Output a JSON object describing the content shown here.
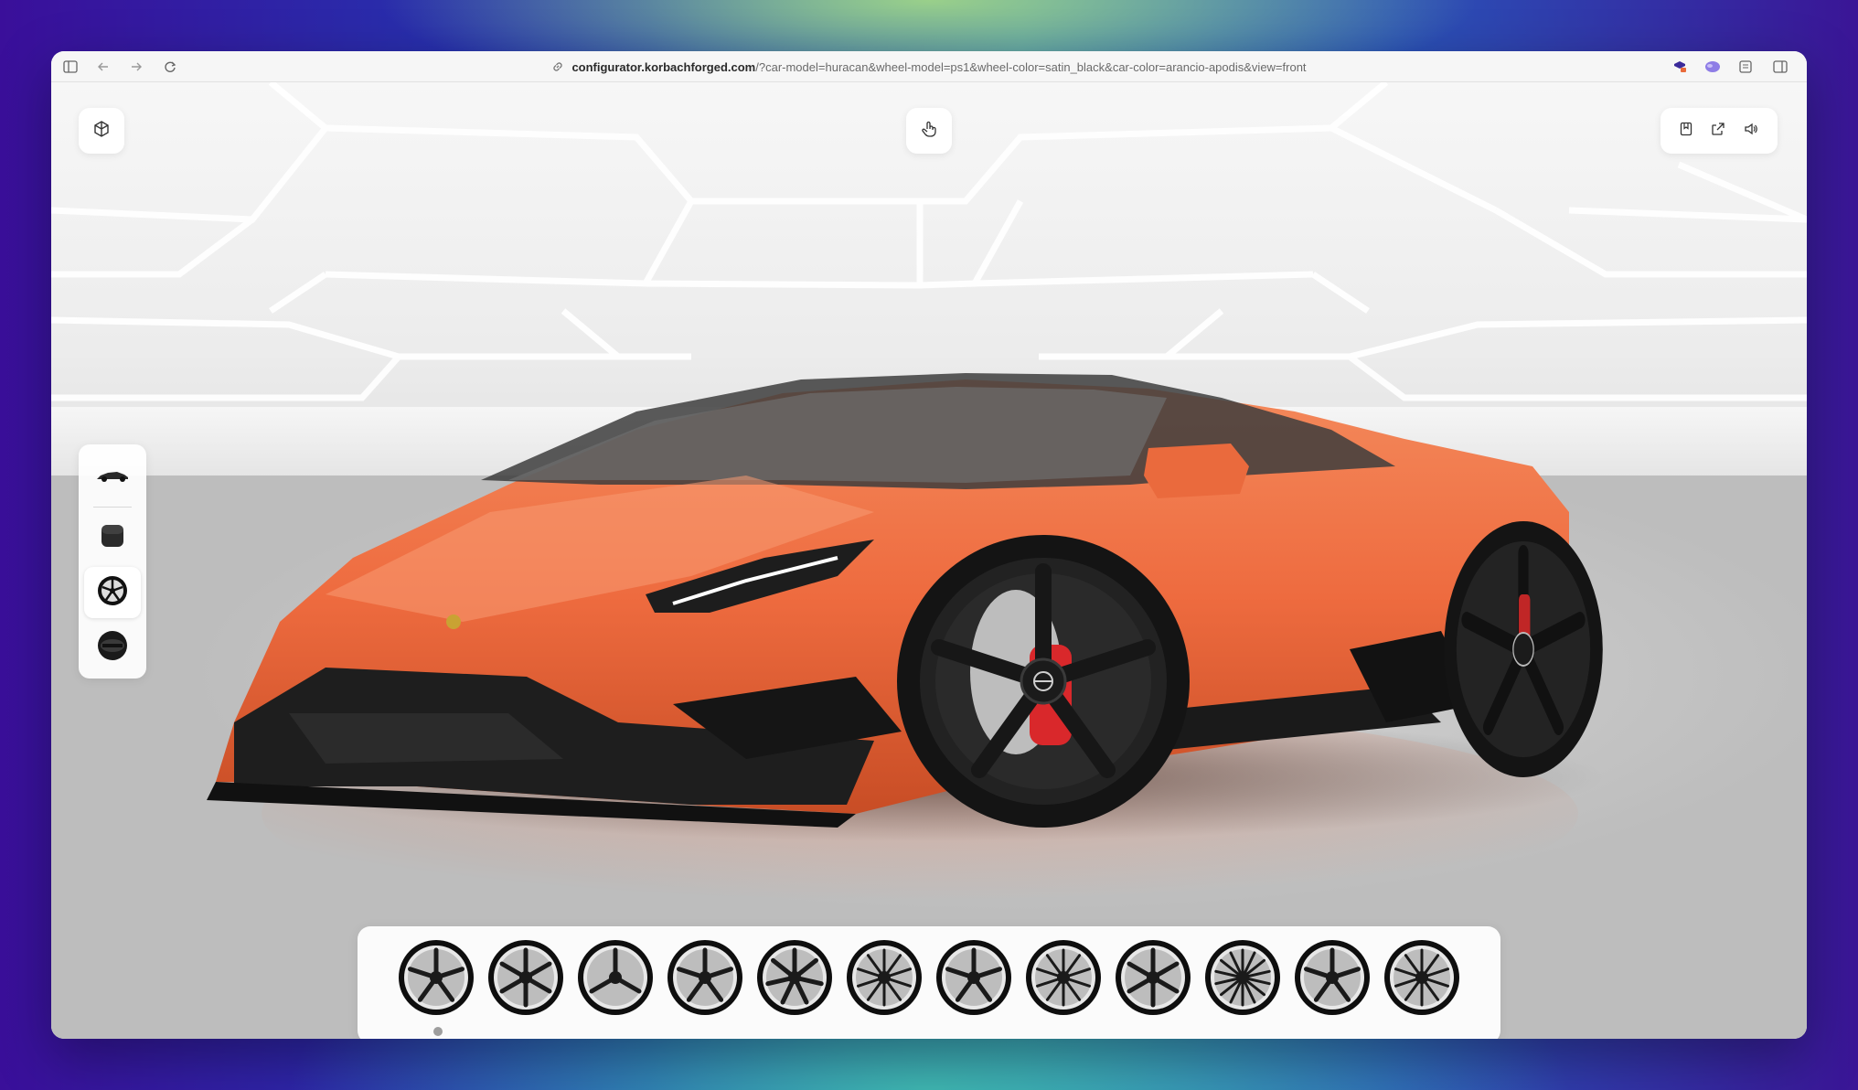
{
  "browser": {
    "url_domain": "configurator.korbachforged.com",
    "url_query": "/?car-model=huracan&wheel-model=ps1&wheel-color=satin_black&car-color=arancio-apodis&view=front",
    "icons": [
      "sidebar-toggle-icon",
      "back-icon",
      "forward-icon",
      "reload-icon",
      "link-icon",
      "extension-icon-1",
      "extension-icon-2",
      "reader-icon",
      "split-view-icon"
    ]
  },
  "configurator": {
    "car_color": "#ee6b3f",
    "wheel_color": "#1c1c1c",
    "top_left_icon": "cube-3d-icon",
    "top_center_icon": "touch-hand-icon",
    "top_right_icons": [
      "save-icon",
      "share-icon",
      "sound-icon"
    ],
    "side_items": [
      {
        "name": "car-model",
        "icon": "car-icon"
      },
      {
        "name": "car-color",
        "icon": "color-swatch-icon"
      },
      {
        "name": "wheel-model",
        "icon": "wheel-icon",
        "active": true
      },
      {
        "name": "wheel-color",
        "icon": "wheel-finish-icon"
      }
    ],
    "wheels": [
      "wheel-1",
      "wheel-2",
      "wheel-3",
      "wheel-4",
      "wheel-5",
      "wheel-6",
      "wheel-7",
      "wheel-8",
      "wheel-9",
      "wheel-10",
      "wheel-11",
      "wheel-12"
    ],
    "selected_wheel_index": 0
  }
}
